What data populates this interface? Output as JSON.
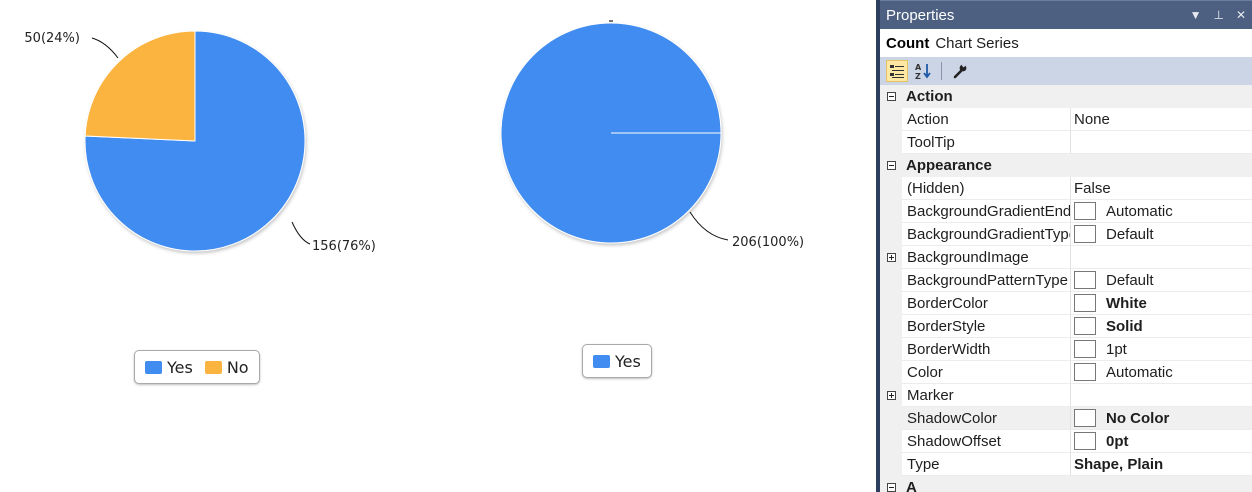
{
  "charts": [
    {
      "slices": [
        {
          "label": "Yes",
          "value": 156,
          "data_label": "156(76%)",
          "color": "#418cf0"
        },
        {
          "label": "No",
          "value": 50,
          "data_label": "50(24%)",
          "color": "#fcb441"
        }
      ],
      "legend": [
        {
          "label": "Yes",
          "color": "#418cf0"
        },
        {
          "label": "No",
          "color": "#fcb441"
        }
      ]
    },
    {
      "slices": [
        {
          "label": "Yes",
          "value": 206,
          "data_label": "206(100%)",
          "color": "#418cf0"
        }
      ],
      "legend": [
        {
          "label": "Yes",
          "color": "#418cf0"
        }
      ]
    }
  ],
  "chart_data": [
    {
      "type": "pie",
      "categories": [
        "Yes",
        "No"
      ],
      "values": [
        156,
        50
      ],
      "data_labels": [
        "156(76%)",
        "50(24%)"
      ],
      "legend": "bottom"
    },
    {
      "type": "pie",
      "categories": [
        "Yes"
      ],
      "values": [
        206
      ],
      "data_labels": [
        "206(100%)"
      ],
      "legend": "bottom"
    }
  ],
  "properties": {
    "title": "Properties",
    "controls": {
      "dropdown": "▼",
      "pin": "⊥",
      "close": "✕"
    },
    "object_name": "Count",
    "object_type": "Chart Series",
    "rows": [
      {
        "kind": "category",
        "label": "Action",
        "expander": "minus"
      },
      {
        "kind": "prop",
        "name": "Action",
        "value": "None"
      },
      {
        "kind": "prop",
        "name": "ToolTip",
        "value": ""
      },
      {
        "kind": "category",
        "label": "Appearance",
        "expander": "minus"
      },
      {
        "kind": "prop",
        "name": "(Hidden)",
        "value": "False"
      },
      {
        "kind": "prop",
        "name": "BackgroundGradientEndColor",
        "value": "Automatic",
        "swatch": true
      },
      {
        "kind": "prop",
        "name": "BackgroundGradientType",
        "value": "Default",
        "swatch": true
      },
      {
        "kind": "prop",
        "name": "BackgroundImage",
        "value": "",
        "expander": "plus"
      },
      {
        "kind": "prop",
        "name": "BackgroundPatternType",
        "value": "Default",
        "swatch": true
      },
      {
        "kind": "prop",
        "name": "BorderColor",
        "value": "White",
        "swatch": true,
        "bold": true
      },
      {
        "kind": "prop",
        "name": "BorderStyle",
        "value": "Solid",
        "swatch": true,
        "bold": true
      },
      {
        "kind": "prop",
        "name": "BorderWidth",
        "value": "1pt",
        "swatch": true
      },
      {
        "kind": "prop",
        "name": "Color",
        "value": "Automatic",
        "swatch": true
      },
      {
        "kind": "prop",
        "name": "Marker",
        "value": "",
        "expander": "plus"
      },
      {
        "kind": "prop",
        "name": "ShadowColor",
        "value": "No Color",
        "swatch": true,
        "bold": true,
        "shaded": true
      },
      {
        "kind": "prop",
        "name": "ShadowOffset",
        "value": "0pt",
        "swatch": true,
        "bold": true
      },
      {
        "kind": "prop",
        "name": "Type",
        "value": "Shape, Plain",
        "bold": true
      },
      {
        "kind": "category",
        "label": "A",
        "expander": "minus"
      }
    ]
  }
}
